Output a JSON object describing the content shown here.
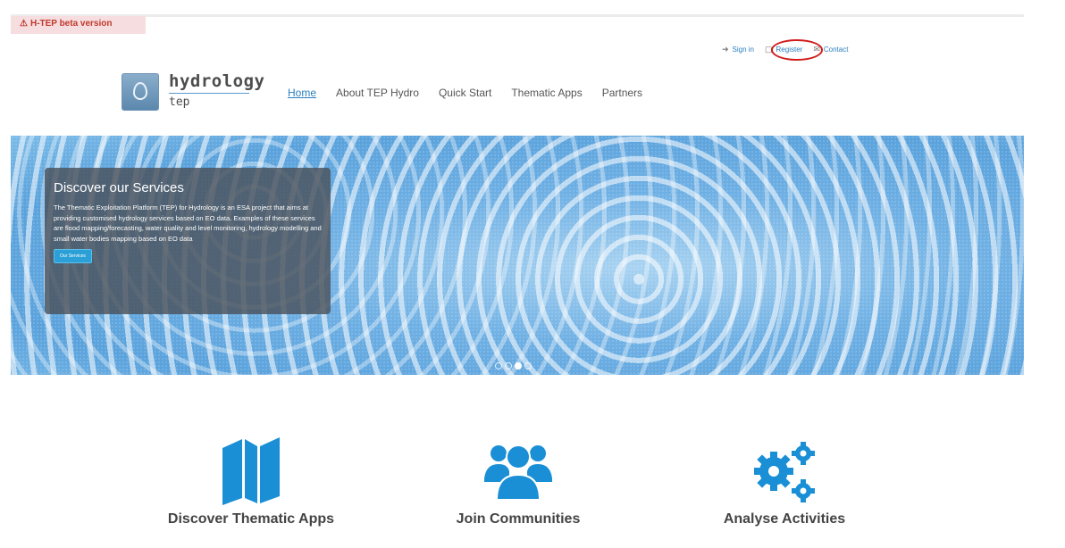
{
  "beta_banner": {
    "text": "H-TEP beta version",
    "icon": "warning-icon",
    "color": "#c0392b"
  },
  "utility_nav": {
    "sign_in": "Sign in",
    "register": "Register",
    "contact": "Contact",
    "highlight_color": "#d11a1a"
  },
  "logo": {
    "title": "hydrology",
    "subtitle": "tep"
  },
  "main_nav": {
    "items": [
      {
        "label": "Home",
        "active": true
      },
      {
        "label": "About TEP Hydro"
      },
      {
        "label": "Quick Start"
      },
      {
        "label": "Thematic Apps"
      },
      {
        "label": "Partners"
      }
    ],
    "active_color": "#2a7fc2"
  },
  "hero": {
    "title": "Discover our Services",
    "body": "The Thematic Exploitation Platform (TEP) for Hydrology is an ESA project that aims at providing customised hydrology services based on EO data. Examples of these services are flood mapping/forecasting, water quality and level monitoring, hydrology modelling and small water bodies mapping based on EO data",
    "button": "Our Services",
    "slides": 4,
    "active_slide": 3
  },
  "features": [
    {
      "label": "Discover Thematic Apps",
      "icon": "map-icon"
    },
    {
      "label": "Join Communities",
      "icon": "users-icon"
    },
    {
      "label": "Analyse Activities",
      "icon": "gears-icon"
    }
  ],
  "colors": {
    "accent": "#2ca0d6",
    "icon_blue": "#1a8fd6"
  }
}
